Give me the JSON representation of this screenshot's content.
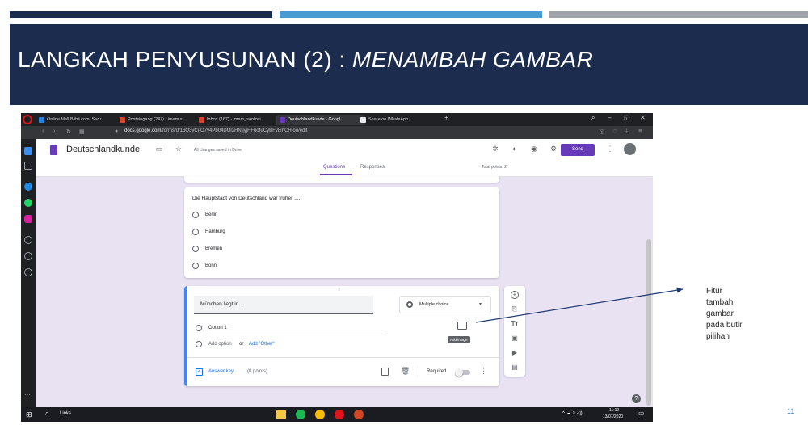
{
  "slide": {
    "title_plain": "LANGKAH PENYUSUNAN (2) : ",
    "title_italic": "MENAMBAH GAMBAR",
    "annotation": [
      "Fitur",
      "tambah",
      "gambar",
      "pada butir",
      "pilihan"
    ],
    "page_number": "11",
    "colors": {
      "band": "#1c2c4e",
      "bar1": "#1c2c4e",
      "bar2": "#4a9cd0",
      "bar3": "#a0a4aa"
    }
  },
  "browser": {
    "tabs": [
      {
        "label": "Online Mall Blibli.com, Seru",
        "color": "#2f81d8"
      },
      {
        "label": "Posteingang (247) - imam.s",
        "color": "#d44638"
      },
      {
        "label": "Inbox (167) - imam_santosi",
        "color": "#d44638"
      },
      {
        "label": "Deutschlandkunde - Googl",
        "color": "#673ab7"
      },
      {
        "label": "Share on WhatsApp",
        "color": "#e8eaed"
      }
    ],
    "new_tab": "+",
    "url_prefix": "docs.google.com",
    "url_rest": "/forms/d/16Q3vCi-O7y4Pb04DOl2HNtjyjHFuofuCyBFv8mCHIoo/edit"
  },
  "form": {
    "doc_title": "Deutschlandkunde",
    "saved_status": "All changes saved in Drive",
    "send_label": "Send",
    "tab_questions": "Questions",
    "tab_responses": "Responses",
    "total_points": "Total points: 2",
    "q1": {
      "text": "Die Hauptstadt von Deutschland war früher .....",
      "options": [
        "Berlin",
        "Hamburg",
        "Bremen",
        "Bonn"
      ]
    },
    "q2": {
      "text": "München liegt in ...",
      "type": "Multiple choice",
      "option1": "Option 1",
      "add_option": "Add option",
      "or": "or",
      "add_other": "Add \"Other\"",
      "image_tooltip": "Add image",
      "answer_key": "Answer key",
      "points": "(0 points)",
      "required": "Required"
    }
  },
  "taskbar": {
    "search_text": "Links",
    "time": "11:19",
    "date": "13/07/2020"
  }
}
